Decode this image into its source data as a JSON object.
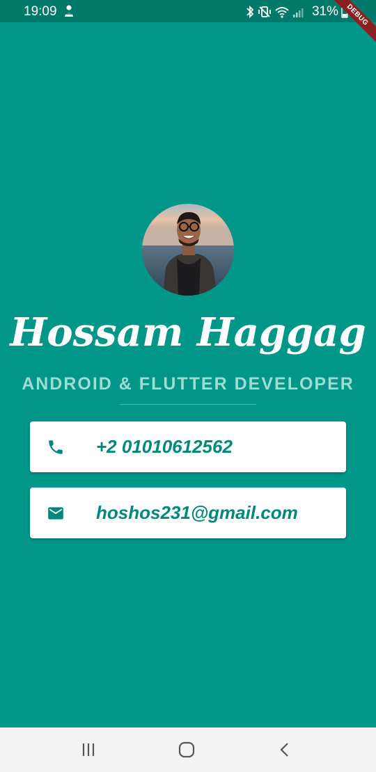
{
  "status_bar": {
    "time": "19:09",
    "battery": "31%",
    "icons": [
      "notification-icon",
      "bluetooth-icon",
      "vibrate-icon",
      "wifi-icon",
      "signal-icon",
      "battery-icon"
    ]
  },
  "debug_banner": {
    "label": "DEBUG",
    "color": "#8b2020"
  },
  "profile": {
    "name": "Hossam Haggag",
    "title": "ANDROID & FLUTTER DEVELOPER"
  },
  "contacts": {
    "phone": {
      "icon": "phone-icon",
      "value": "+2 01010612562"
    },
    "email": {
      "icon": "email-icon",
      "value": "hoshos231@gmail.com"
    }
  },
  "nav_bar": {
    "buttons": [
      "recents-icon",
      "home-icon",
      "back-icon"
    ]
  },
  "colors": {
    "background": "#009688",
    "status_bar": "#00796b",
    "accent_text": "#00897b",
    "subtitle": "#9fdcd3",
    "card": "#ffffff"
  }
}
